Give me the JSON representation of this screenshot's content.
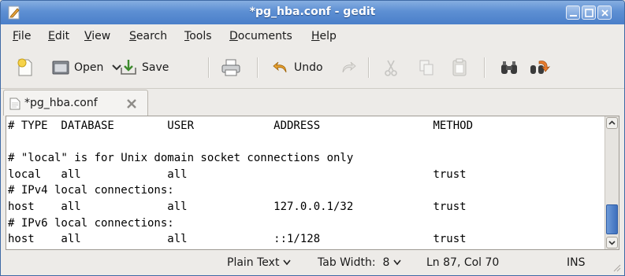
{
  "window": {
    "title": "*pg_hba.conf - gedit"
  },
  "menu": [
    "File",
    "Edit",
    "View",
    "Search",
    "Tools",
    "Documents",
    "Help"
  ],
  "toolbar": {
    "open_label": "Open",
    "save_label": "Save",
    "undo_label": "Undo"
  },
  "tab": {
    "label": "*pg_hba.conf"
  },
  "editor": {
    "lines": [
      "# TYPE  DATABASE        USER            ADDRESS                 METHOD",
      "",
      "# \"local\" is for Unix domain socket connections only",
      "local   all             all                                     trust",
      "# IPv4 local connections:",
      "host    all             all             127.0.0.1/32            trust",
      "# IPv6 local connections:",
      "host    all             all             ::1/128                 trust"
    ]
  },
  "status": {
    "language": "Plain Text",
    "tab_width": "Tab Width:  8",
    "position": "Ln 87, Col 70",
    "mode": "INS"
  },
  "colors": {
    "titlebar": "#5d8fd3",
    "scroll_thumb": "#4a7fc9"
  }
}
